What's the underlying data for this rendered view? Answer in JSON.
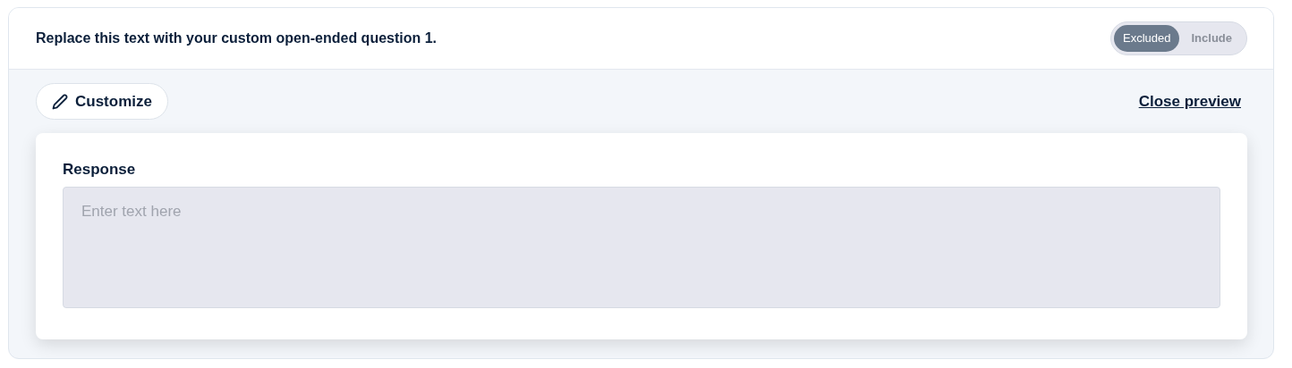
{
  "question": {
    "title": "Replace this text with your custom open-ended question 1."
  },
  "toggle": [
    {
      "label": "Excluded",
      "selected": true
    },
    {
      "label": "Include",
      "selected": false
    }
  ],
  "customize_button": {
    "label": "Customize"
  },
  "close_link": {
    "label": "Close preview"
  },
  "response": {
    "label": "Response",
    "placeholder": "Enter text here"
  }
}
